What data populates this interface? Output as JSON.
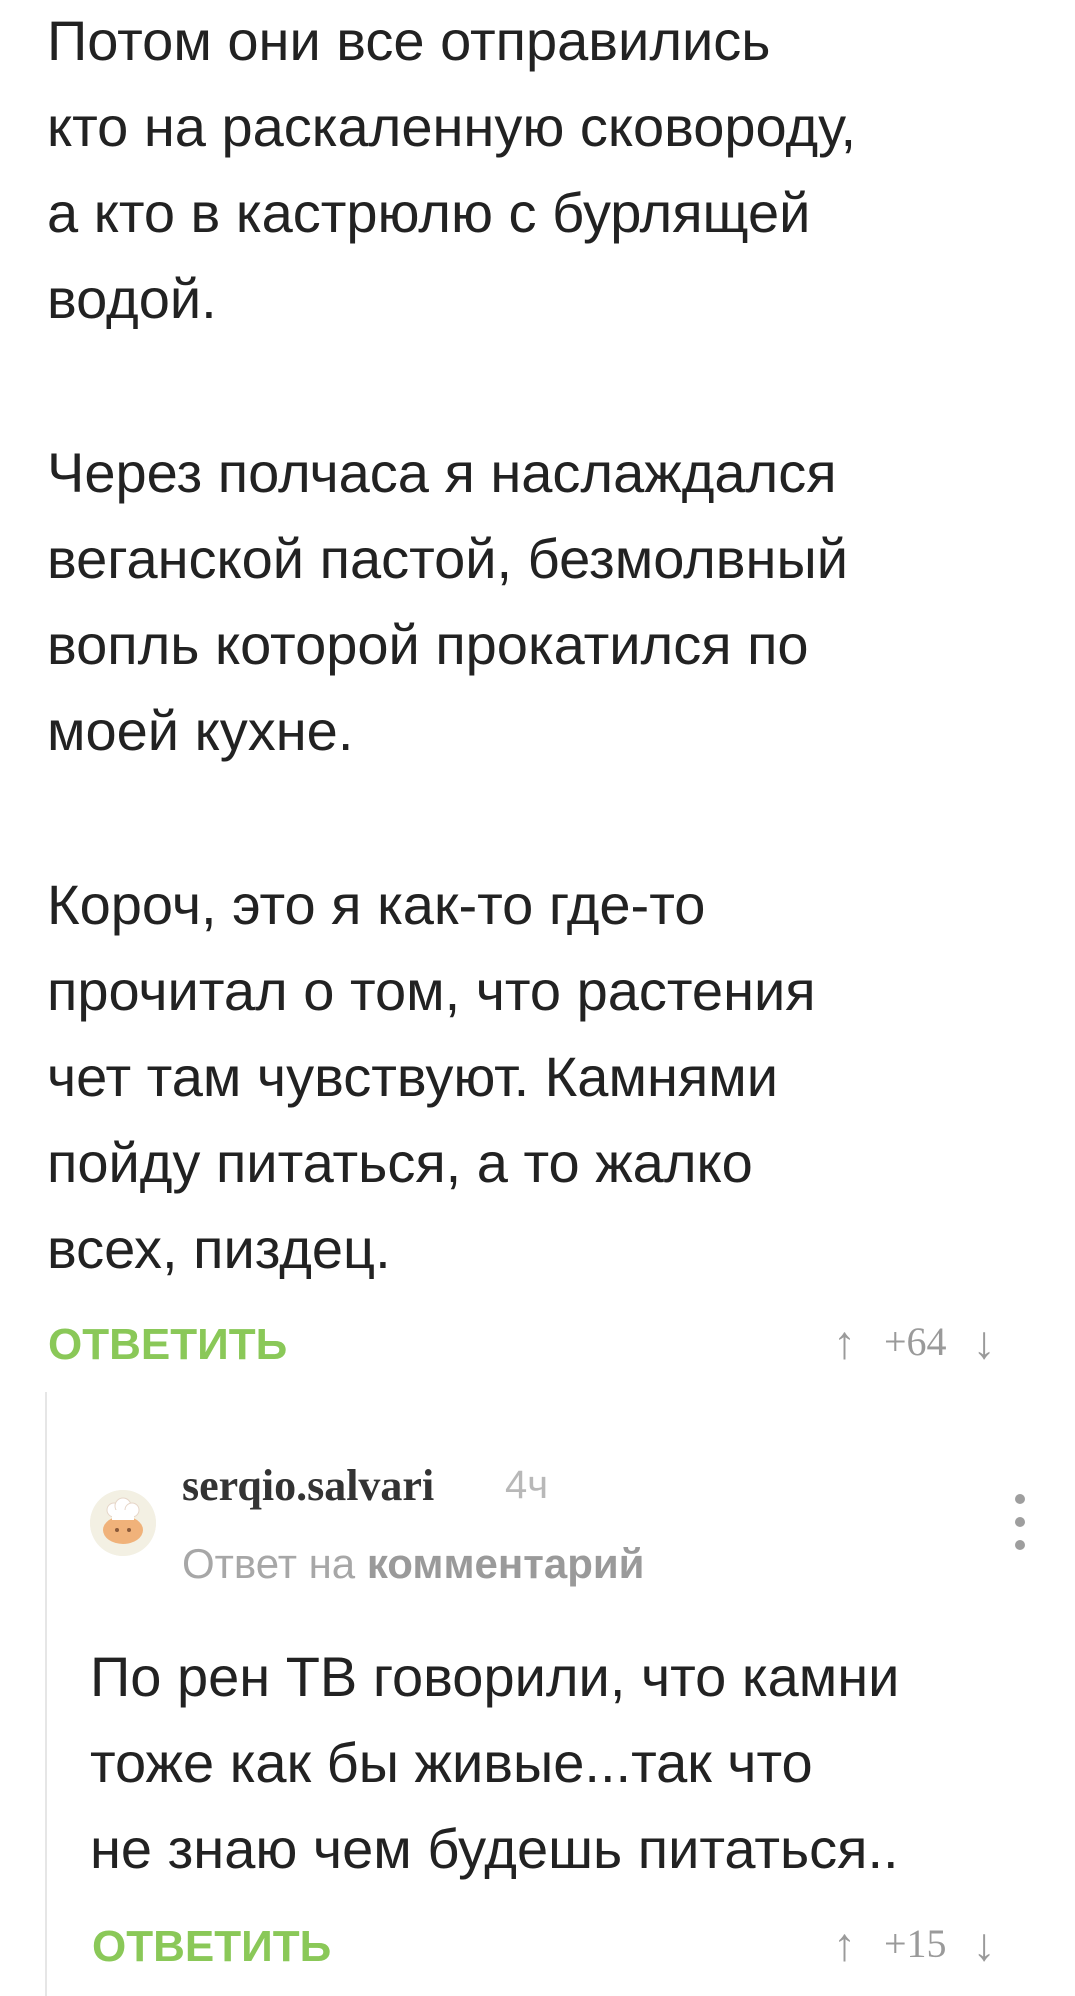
{
  "comment": {
    "paragraphs": [
      [
        "Потом они все отправились",
        "кто на раскаленную сковороду,",
        "а кто в кастрюлю с бурлящей",
        "водой."
      ],
      [
        "Через полчаса я наслаждался",
        "веганской пастой, безмолвный",
        "вопль которой прокатился по",
        "моей кухне."
      ],
      [
        "Короч, это я как-то где-то",
        "прочитал о том, что растения",
        "чет там чувствуют. Камнями",
        "пойду питаться, а то жалко",
        "всех, пиздец."
      ]
    ],
    "reply_label": "ОТВЕТИТЬ",
    "score": "+64"
  },
  "reply": {
    "username": "serqio.salvari",
    "time": "4ч",
    "reply_prefix": "Ответ на",
    "reply_link": "комментарий",
    "lines": [
      "По рен ТВ говорили, что камни",
      "тоже как бы живые...так что",
      "не знаю чем будешь питаться.."
    ],
    "reply_label": "ОТВЕТИТЬ",
    "score": "+15"
  },
  "icons": {
    "upvote": "arrow-up-icon",
    "downvote": "arrow-down-icon",
    "more": "more-vertical-icon",
    "avatar": "chef-avatar"
  },
  "colors": {
    "accent": "#8ac858",
    "text": "#222222",
    "muted": "#9a9a9a"
  }
}
